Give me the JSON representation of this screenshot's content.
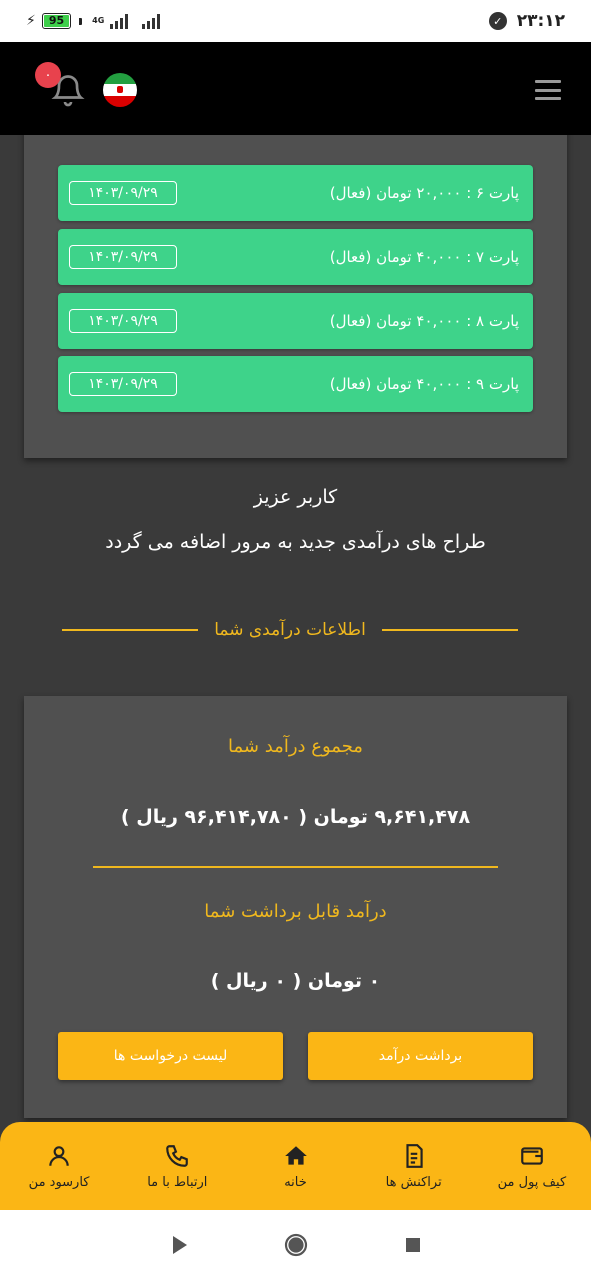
{
  "status_bar": {
    "time": "۲۳:۱۲",
    "battery": "95",
    "network": "4G"
  },
  "header": {
    "notification_count": "۰"
  },
  "parts": [
    {
      "label": "پارت ۶ : ۲۰,۰۰۰ تومان (فعال)",
      "date": "۱۴۰۳/۰۹/۲۹"
    },
    {
      "label": "پارت ۷ : ۴۰,۰۰۰ تومان (فعال)",
      "date": "۱۴۰۳/۰۹/۲۹"
    },
    {
      "label": "پارت ۸ : ۴۰,۰۰۰ تومان (فعال)",
      "date": "۱۴۰۳/۰۹/۲۹"
    },
    {
      "label": "پارت ۹ : ۴۰,۰۰۰ تومان (فعال)",
      "date": "۱۴۰۳/۰۹/۲۹"
    }
  ],
  "notice": {
    "greeting": "کاربر عزیز",
    "message": "طراح های درآمدی جدید به مرور اضافه می گردد"
  },
  "section_title": "اطلاعات درآمدی شما",
  "income": {
    "total_title": "مجموع درآمد شما",
    "total_value": "۹,۶۴۱,۴۷۸ تومان ( ۹۶,۴۱۴,۷۸۰ ریال )",
    "withdrawable_title": "درآمد قابل برداشت شما",
    "withdrawable_value": "۰ تومان ( ۰ ریال )",
    "withdraw_button": "برداشت درآمد",
    "requests_button": "لیست درخواست ها"
  },
  "bottom_nav": [
    {
      "label": "کیف پول من",
      "icon": "wallet-icon"
    },
    {
      "label": "تراکنش ها",
      "icon": "receipt-icon"
    },
    {
      "label": "خانه",
      "icon": "home-icon"
    },
    {
      "label": "ارتباط با ما",
      "icon": "phone-icon"
    },
    {
      "label": "کارسود من",
      "icon": "user-icon"
    }
  ],
  "colors": {
    "accent": "#fbb615",
    "gold_text": "#f0b81e",
    "part_green": "#3ed38a",
    "card_bg": "#505050",
    "page_bg": "#3a3a3a"
  }
}
